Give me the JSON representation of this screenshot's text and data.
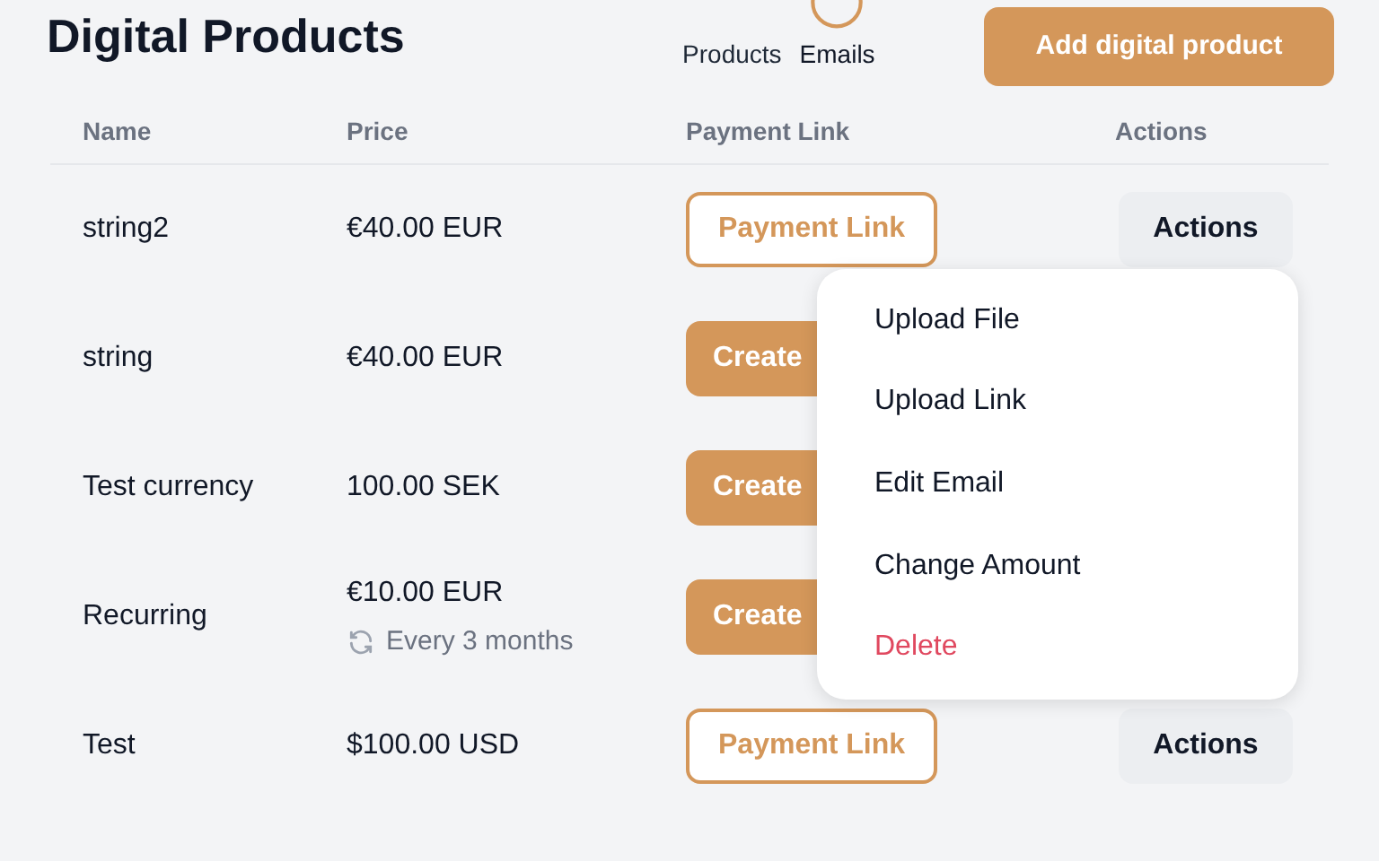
{
  "header": {
    "title": "Digital Products",
    "tabs": [
      {
        "label": "Products",
        "selected": false
      },
      {
        "label": "Emails",
        "selected": true
      }
    ],
    "add_button": "Add digital product"
  },
  "table": {
    "columns": [
      "Name",
      "Price",
      "Payment Link",
      "Actions"
    ],
    "rows": [
      {
        "name": "string2",
        "price": "€40.00 EUR",
        "link": {
          "kind": "outline",
          "label": "Payment Link"
        },
        "actions": "Actions"
      },
      {
        "name": "string",
        "price": "€40.00 EUR",
        "link": {
          "kind": "filled",
          "label": "Create"
        }
      },
      {
        "name": "Test currency",
        "price": "100.00 SEK",
        "link": {
          "kind": "filled",
          "label": "Create"
        }
      },
      {
        "name": "Recurring",
        "price": "€10.00 EUR",
        "recurrence": "Every 3 months",
        "link": {
          "kind": "filled",
          "label": "Create"
        }
      },
      {
        "name": "Test",
        "price": "$100.00 USD",
        "link": {
          "kind": "outline",
          "label": "Payment Link"
        },
        "actions": "Actions"
      }
    ]
  },
  "menu": {
    "items": [
      {
        "label": "Upload File",
        "kind": "normal"
      },
      {
        "label": "Upload Link",
        "kind": "normal"
      },
      {
        "label": "Edit Email",
        "kind": "normal"
      },
      {
        "label": "Change Amount",
        "kind": "normal"
      },
      {
        "label": "Delete",
        "kind": "danger"
      }
    ]
  }
}
